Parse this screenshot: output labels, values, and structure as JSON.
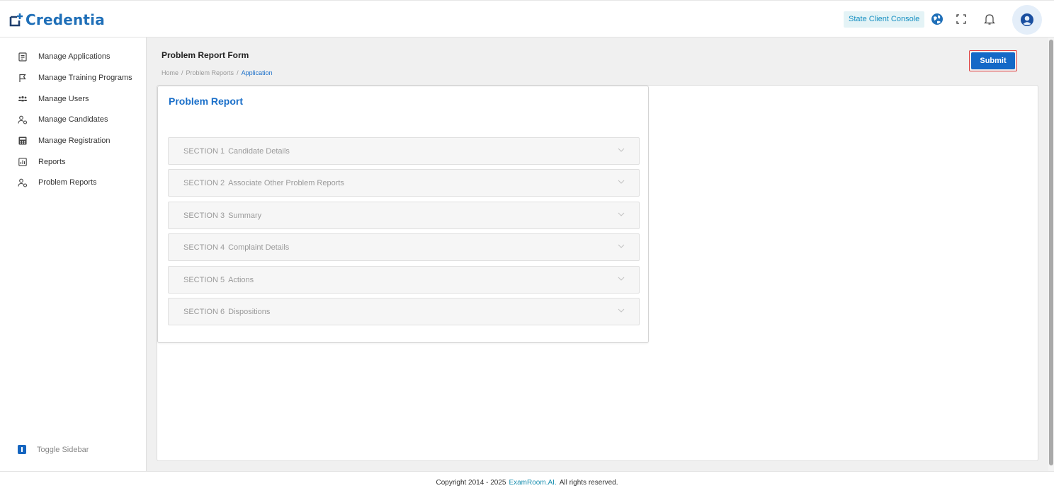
{
  "header": {
    "logo_text": "Credentia",
    "console_label": "State Client Console",
    "colors": {
      "brand": "#1f6fb8",
      "accent": "#1469c7"
    }
  },
  "sidebar": {
    "items": [
      {
        "label": "Manage Applications",
        "icon": "document-icon"
      },
      {
        "label": "Manage Training Programs",
        "icon": "flag-icon"
      },
      {
        "label": "Manage Users",
        "icon": "users-icon"
      },
      {
        "label": "Manage Candidates",
        "icon": "candidates-icon"
      },
      {
        "label": "Manage Registration",
        "icon": "calculator-icon"
      },
      {
        "label": "Reports",
        "icon": "chart-icon"
      },
      {
        "label": "Problem Reports",
        "icon": "problem-reports-icon"
      }
    ],
    "toggle_label": "Toggle Sidebar"
  },
  "main": {
    "page_title": "Problem Report Form",
    "breadcrumb": [
      "Home",
      "Problem Reports",
      "Application"
    ],
    "submit_label": "Submit",
    "card_title": "Problem Report",
    "sections": [
      {
        "number": "SECTION 1",
        "name": "Candidate Details"
      },
      {
        "number": "SECTION 2",
        "name": "Associate Other Problem Reports"
      },
      {
        "number": "SECTION 3",
        "name": "Summary"
      },
      {
        "number": "SECTION 4",
        "name": "Complaint Details"
      },
      {
        "number": "SECTION 5",
        "name": "Actions"
      },
      {
        "number": "SECTION 6",
        "name": "Dispositions"
      }
    ]
  },
  "footer": {
    "prefix": "Copyright 2014 - 2025",
    "brand": "ExamRoom.AI.",
    "suffix": "All rights reserved."
  }
}
